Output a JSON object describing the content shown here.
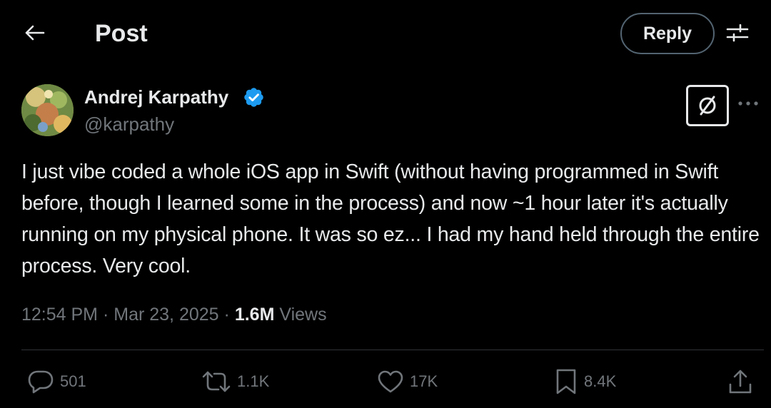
{
  "header": {
    "title": "Post",
    "reply_label": "Reply",
    "back_icon": "arrow-left-icon",
    "filter_icon": "sliders-icon"
  },
  "author": {
    "name": "Andrej Karpathy",
    "handle": "@karpathy",
    "verified_icon": "verified-badge-icon",
    "verified_color": "#1d9bf0"
  },
  "post": {
    "text": "I just vibe coded a whole iOS app in Swift (without having programmed in Swift before, though I learned some in the process) and now ~1 hour later it's actually running on my physical phone. It was so ez... I had my hand held through the entire process. Very cool."
  },
  "meta": {
    "time": "12:54 PM",
    "separator": "·",
    "date": "Mar 23, 2025",
    "views_count": "1.6M",
    "views_label": "Views"
  },
  "actions": {
    "replies": "501",
    "reposts": "1.1K",
    "likes": "17K",
    "bookmarks": "8.4K"
  },
  "colors": {
    "background": "#000000",
    "text_primary": "#e7e9ea",
    "text_secondary": "#71767b",
    "border": "#2f3336",
    "accent": "#1d9bf0"
  }
}
